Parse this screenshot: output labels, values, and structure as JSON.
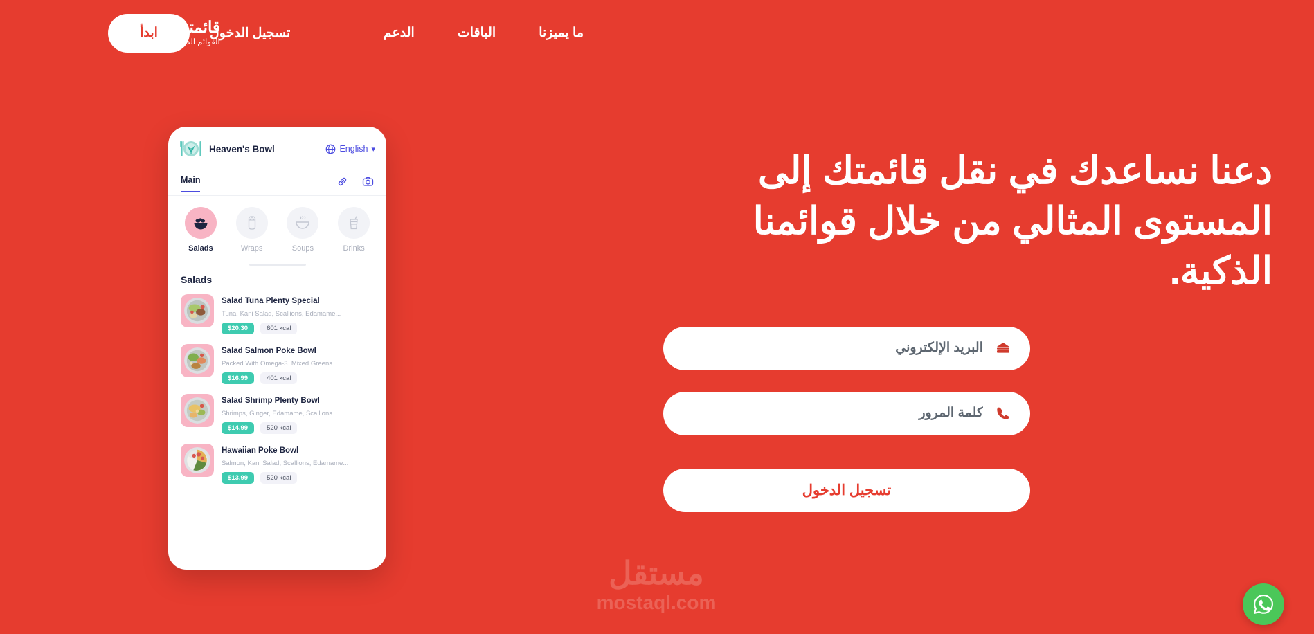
{
  "theme": {
    "background": "#e63c2f",
    "accent_white": "#ffffff",
    "phone_accent": "#4c4ce0",
    "price_badge": "#3ecbb0",
    "category_active": "#f8b4c4",
    "whatsapp_green": "#4bc759"
  },
  "navbar": {
    "brand_title": "قائمتي",
    "brand_subtitle": "القوائم الذكية",
    "links": [
      {
        "label": "ما يميزنا"
      },
      {
        "label": "الباقات"
      },
      {
        "label": "الدعم"
      }
    ],
    "login_label": "تسجيل الدخول",
    "start_label": "ابدأ"
  },
  "hero": {
    "headline": "دعنا نساعدك في نقل قائمتك إلى المستوى المثالي من خلال قوائمنا الذكية.",
    "form": {
      "email_placeholder": "البريد الإلكتروني",
      "email_value": "",
      "password_placeholder": "كلمة المرور",
      "password_value": "",
      "submit_label": "تسجيل الدخول"
    }
  },
  "phone": {
    "restaurant_name": "Heaven's Bowl",
    "language": "English",
    "tab_label": "Main",
    "categories": [
      {
        "label": "Salads",
        "active": true
      },
      {
        "label": "Wraps",
        "active": false
      },
      {
        "label": "Soups",
        "active": false
      },
      {
        "label": "Drinks",
        "active": false
      }
    ],
    "section_title": "Salads",
    "items": [
      {
        "name": "Salad Tuna Plenty Special",
        "description": "Tuna, Kani Salad, Scallions, Edamame...",
        "price": "$20.30",
        "calories": "601 kcal"
      },
      {
        "name": "Salad Salmon Poke Bowl",
        "description": "Packed With Omega-3. Mixed Greens...",
        "price": "$16.99",
        "calories": "401 kcal"
      },
      {
        "name": "Salad Shrimp Plenty Bowl",
        "description": "Shrimps, Ginger, Edamame, Scallions...",
        "price": "$14.99",
        "calories": "520 kcal"
      },
      {
        "name": "Hawaiian Poke Bowl",
        "description": "Salmon, Kani Salad, Scallions, Edamame...",
        "price": "$13.99",
        "calories": "520 kcal"
      }
    ]
  },
  "watermark": {
    "arabic": "مستقل",
    "latin": "mostaql.com"
  }
}
